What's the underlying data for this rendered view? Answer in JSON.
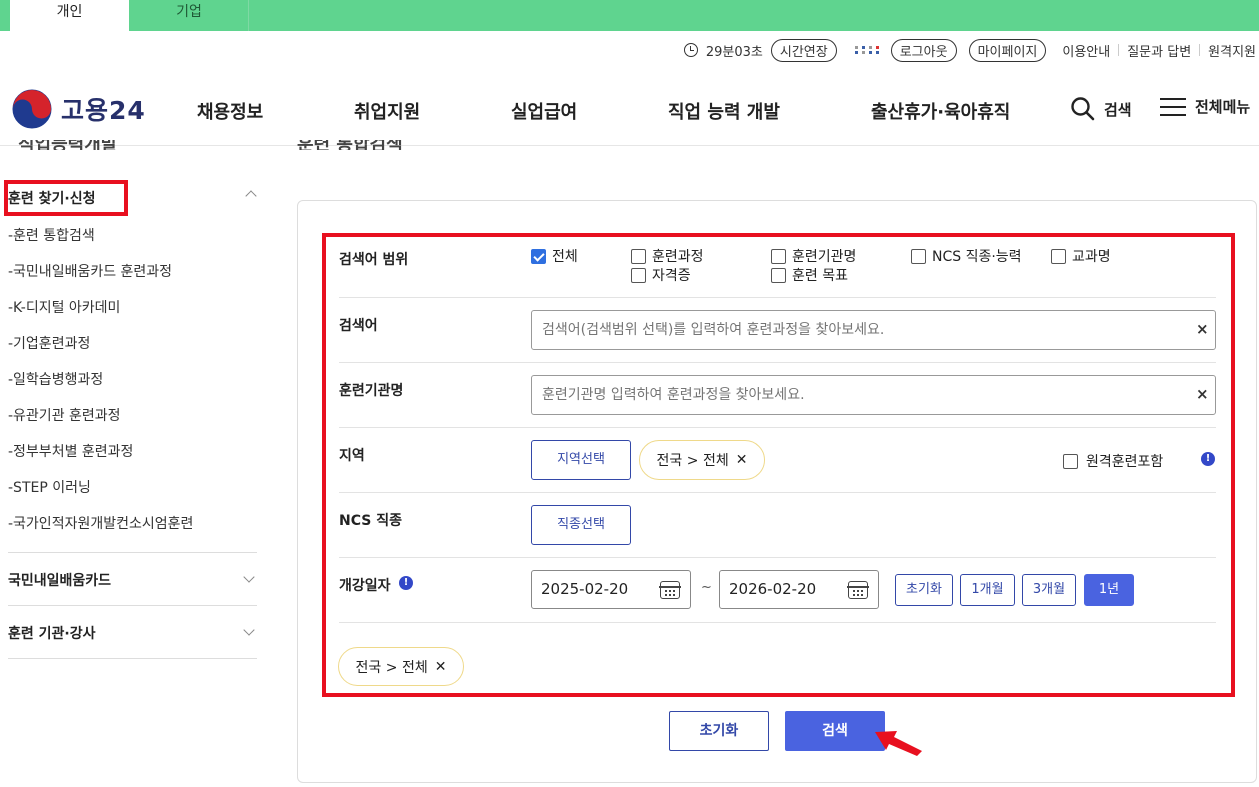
{
  "tabs": {
    "personal": "개인",
    "business": "기업"
  },
  "util": {
    "timer": "29분03초",
    "extend": "시간연장",
    "logout": "로그아웃",
    "mypage": "마이페이지",
    "guide": "이용안내",
    "qna": "질문과 답변",
    "remote": "원격지원"
  },
  "header": {
    "logo": "고용24",
    "nav": [
      "채용정보",
      "취업지원",
      "실업급여",
      "직업 능력 개발",
      "출산휴가·육아휴직"
    ],
    "search": "검색",
    "allmenu": "전체메뉴"
  },
  "sidebar": {
    "active_group": "훈련 찾기·신청",
    "items": [
      "-훈련 통합검색",
      "-국민내일배움카드 훈련과정",
      "-K-디지털 아카데미",
      "-기업훈련과정",
      "-일학습병행과정",
      "-유관기관 훈련과정",
      "-정부부처별 훈련과정",
      "-STEP 이러닝",
      "-국가인적자원개발컨소시엄훈련"
    ],
    "groups": [
      "국민내일배움카드",
      "훈련 기관·강사"
    ]
  },
  "form": {
    "scope_label": "검색어 범위",
    "scope_options": [
      {
        "label": "전체",
        "checked": true
      },
      {
        "label": "훈련과정",
        "checked": false
      },
      {
        "label": "훈련기관명",
        "checked": false
      },
      {
        "label": "NCS 직종·능력",
        "checked": false
      },
      {
        "label": "교과명",
        "checked": false
      },
      {
        "label": "자격증",
        "checked": false
      },
      {
        "label": "훈련 목표",
        "checked": false
      }
    ],
    "keyword_label": "검색어",
    "keyword_placeholder": "검색어(검색범위 선택)를 입력하여 훈련과정을 찾아보세요.",
    "inst_label": "훈련기관명",
    "inst_placeholder": "훈련기관명 입력하여 훈련과정을 찾아보세요.",
    "region_label": "지역",
    "region_button": "지역선택",
    "region_chip": "전국 > 전체",
    "remote_label": "원격훈련포함",
    "ncs_label": "NCS 직종",
    "ncs_button": "직종선택",
    "date_label": "개강일자",
    "date_from": "2025-02-20",
    "date_sep": "~",
    "date_to": "2026-02-20",
    "period_buttons": [
      "초기화",
      "1개월",
      "3개월",
      "1년"
    ],
    "selected_chip": "전국 > 전체",
    "reset": "초기화",
    "search": "검색"
  },
  "colors": {
    "accent": "#4a63e0",
    "highlight": "#e8101f",
    "topbar": "#5fd48f"
  }
}
